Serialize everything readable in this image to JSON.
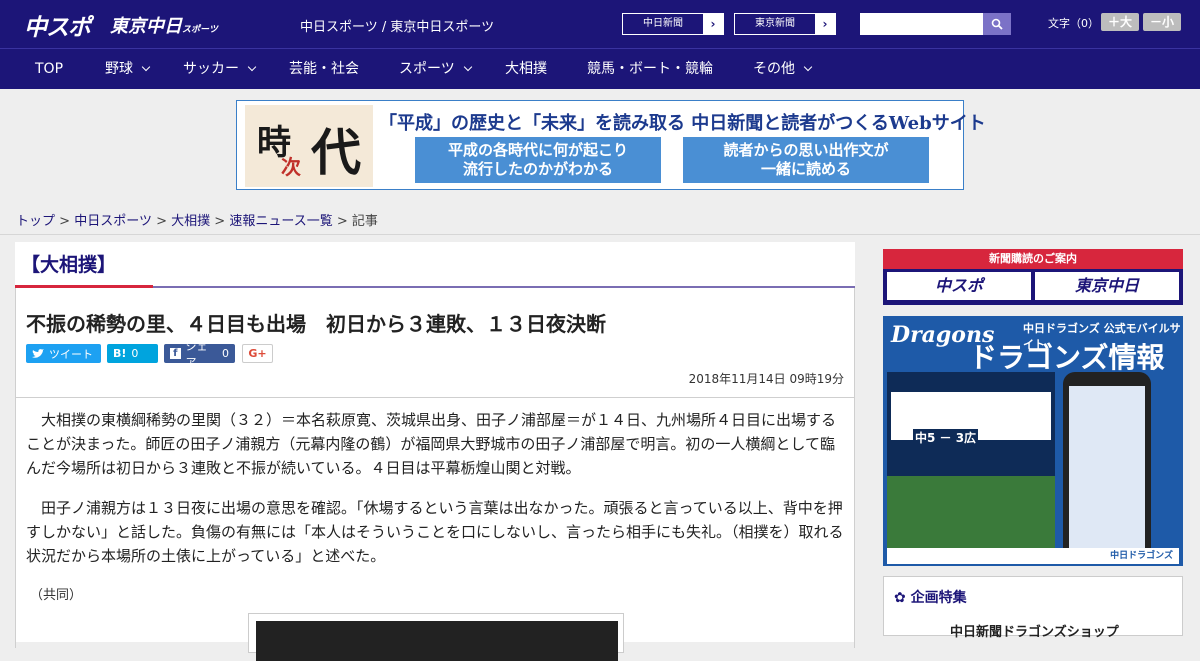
{
  "header": {
    "logo_chuspo": "中スポ",
    "logo_tokyo": "東京中日",
    "logo_tokyo_suffix": "スポーツ",
    "site_links": "中日スポーツ / 東京中日スポーツ",
    "buttons": [
      {
        "label": "中日新聞",
        "arrow": "›"
      },
      {
        "label": "東京新聞",
        "arrow": "›"
      }
    ],
    "search": {
      "placeholder": ""
    },
    "font_size_label": "文字（0）",
    "font_bigger": "＋大",
    "font_smaller": "－小"
  },
  "nav": {
    "items": [
      {
        "label": "TOP"
      },
      {
        "label": "野球"
      },
      {
        "label": "サッカー"
      },
      {
        "label": "芸能・社会"
      },
      {
        "label": "スポーツ"
      },
      {
        "label": "大相撲"
      },
      {
        "label": "競馬・ボート・競輪"
      },
      {
        "label": "その他"
      }
    ]
  },
  "banner": {
    "kanji_1": "時",
    "kanji_2": "次",
    "kanji_3": "代",
    "headline": "「平成」の歴史と「未来」を読み取る 中日新聞と読者がつくるWebサイト",
    "box_left_1": "平成の各時代に何が起こり",
    "box_left_2": "流行したのかがわかる",
    "box_right_1": "読者からの思い出作文が",
    "box_right_2": "一緒に読める"
  },
  "breadcrumb": {
    "items": [
      "トップ",
      "中日スポーツ",
      "大相撲",
      "速報ニュース一覧"
    ],
    "separator": ">",
    "current": "記事"
  },
  "article": {
    "category": "【大相撲】",
    "title": "不振の稀勢の里、４日目も出場　初日から３連敗、１３日夜決断",
    "share": {
      "tweet": "ツイート",
      "hatena": "B!",
      "hatena_count": "0",
      "facebook": "シェア",
      "facebook_count": "0",
      "gplus": "G+"
    },
    "date": "2018年11月14日 09時19分",
    "paragraphs": [
      "大相撲の東横綱稀勢の里関（３２）＝本名萩原寛、茨城県出身、田子ノ浦部屋＝が１４日、九州場所４日目に出場することが決まった。師匠の田子ノ浦親方（元幕内隆の鶴）が福岡県大野城市の田子ノ浦部屋で明言。初の一人横綱として臨んだ今場所は初日から３連敗と不振が続いている。４日目は平幕栃煌山関と対戦。",
      "田子ノ浦親方は１３日夜に出場の意思を確認。「休場するという言葉は出なかった。頑張ると言っている以上、背中を押すしかない」と話した。負傷の有無には「本人はそういうことを口にしないし、言ったら相手にも失礼。（相撲を）取れる状況だから本場所の土俵に上がっている」と述べた。"
    ],
    "credit": "（共同）"
  },
  "sidebar": {
    "subscribe_caption": "新聞購読のご案内",
    "subscribe_chuspo": "中スポ",
    "subscribe_tokyo": "東京中日",
    "dragons_logo": "Dragons",
    "dragons_small": "中日ドラゴンズ 公式モバイルサイト",
    "dragons_title": "ドラゴンズ情報",
    "dragons_score": "中5 － 3広",
    "dragons_footer": "中日ドラゴンズ",
    "feature_heading": "企画特集",
    "feature_item": "中日新聞ドラゴンズショップ"
  },
  "colors": {
    "brand": "#1c1578",
    "accent_red": "#d7263d",
    "dragons_blue": "#1e5aa8"
  }
}
